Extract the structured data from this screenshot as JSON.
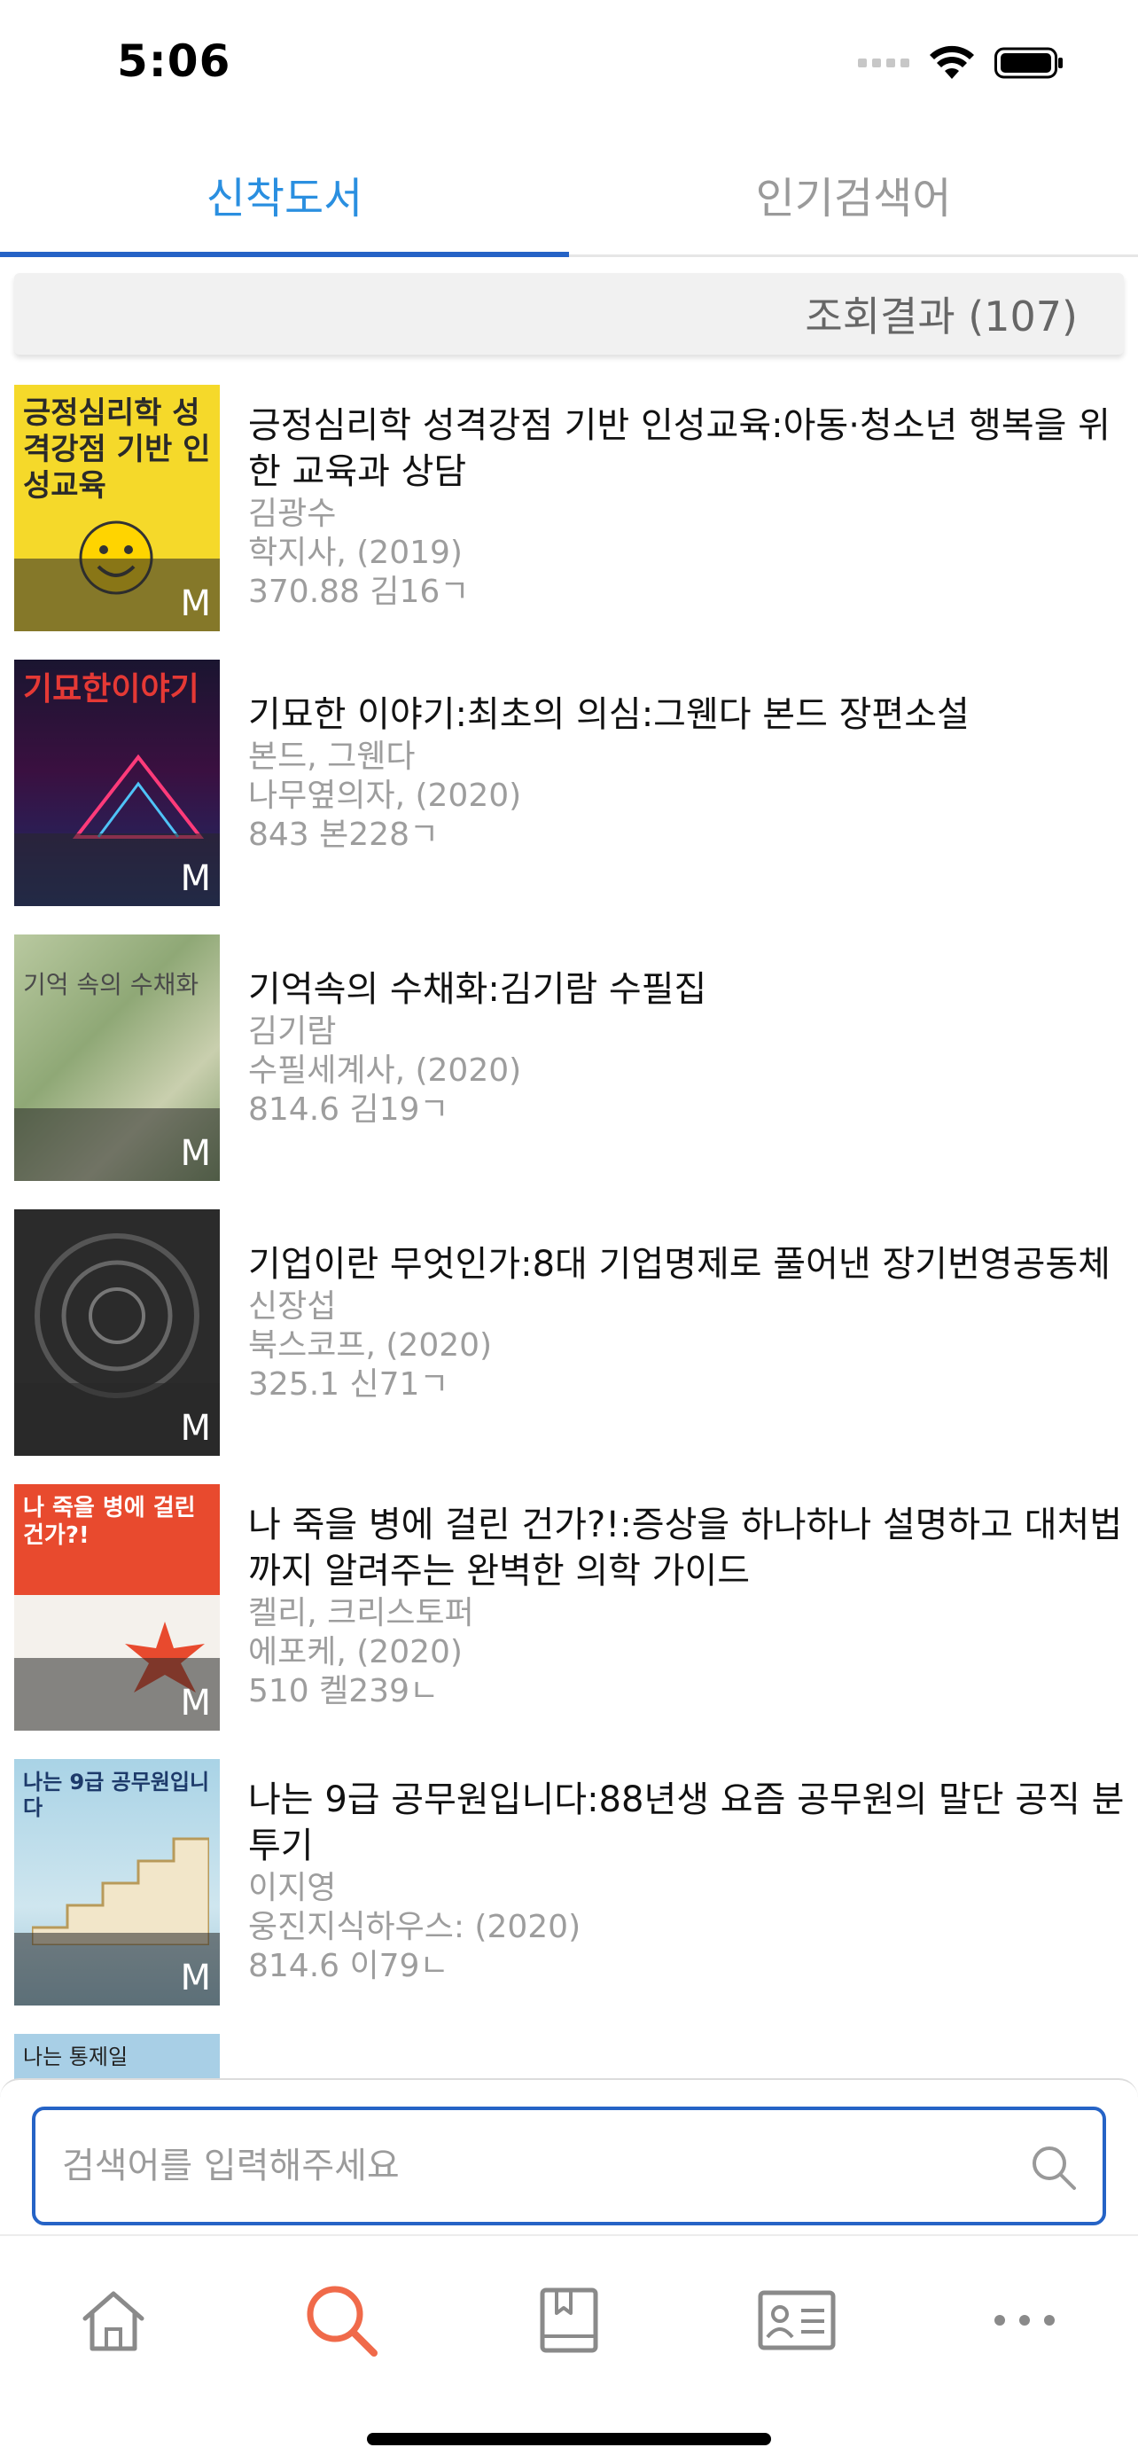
{
  "status": {
    "time": "5:06"
  },
  "tabs": [
    {
      "label": "신착도서",
      "active": true
    },
    {
      "label": "인기검색어",
      "active": false
    }
  ],
  "result": {
    "text": "조회결과 (107)"
  },
  "books": [
    {
      "title": "긍정심리학 성격강점 기반 인성교육:아동·청소년 행복을 위한 교육과 상담",
      "author": "김광수",
      "publisher": "학지사, (2019)",
      "call_number": "370.88 김16ㄱ",
      "badge": "M",
      "cover_text": "긍정심리학 성격강점 기반 인성교육"
    },
    {
      "title": "기묘한 이야기:최초의 의심:그웬다 본드 장편소설",
      "author": "본드, 그웬다",
      "publisher": "나무옆의자, (2020)",
      "call_number": "843 본228ㄱ",
      "badge": "M",
      "cover_text": "기묘한이야기"
    },
    {
      "title": "기억속의 수채화:김기람 수필집",
      "author": "김기람",
      "publisher": "수필세계사, (2020)",
      "call_number": "814.6 김19ㄱ",
      "badge": "M",
      "cover_text": "기억 속의 수채화"
    },
    {
      "title": "기업이란 무엇인가:8대 기업명제로 풀어낸 장기번영공동체",
      "author": "신장섭",
      "publisher": "북스코프, (2020)",
      "call_number": "325.1 신71ㄱ",
      "badge": "M",
      "cover_text": ""
    },
    {
      "title": "나 죽을 병에 걸린 건가?!:증상을 하나하나 설명하고 대처법까지 알려주는 완벽한 의학 가이드",
      "author": "켈리, 크리스토퍼",
      "publisher": "에포케, (2020)",
      "call_number": "510 켈239ㄴ",
      "badge": "M",
      "cover_text": "나 죽을 병에 걸린 건가?!"
    },
    {
      "title": "나는 9급 공무원입니다:88년생 요즘 공무원의 말단 공직 분투기",
      "author": "이지영",
      "publisher": "웅진지식하우스: (2020)",
      "call_number": "814.6 이79ㄴ",
      "badge": "M",
      "cover_text": "나는 9급 공무원입니다"
    },
    {
      "title": "",
      "author": "",
      "publisher": "",
      "call_number": "",
      "badge": "",
      "cover_text": "나는 통제일"
    }
  ],
  "search": {
    "placeholder": "검색어를 입력해주세요",
    "value": ""
  },
  "nav": [
    {
      "icon": "home-icon",
      "active": false
    },
    {
      "icon": "search-icon",
      "active": true
    },
    {
      "icon": "book-icon",
      "active": false
    },
    {
      "icon": "id-card-icon",
      "active": false
    },
    {
      "icon": "more-icon",
      "active": false
    }
  ],
  "colors": {
    "accent": "#2563c6",
    "tab_active_text": "#2a8fe0",
    "nav_active": "#f06a4a",
    "nav_inactive": "#8a8a8a"
  }
}
